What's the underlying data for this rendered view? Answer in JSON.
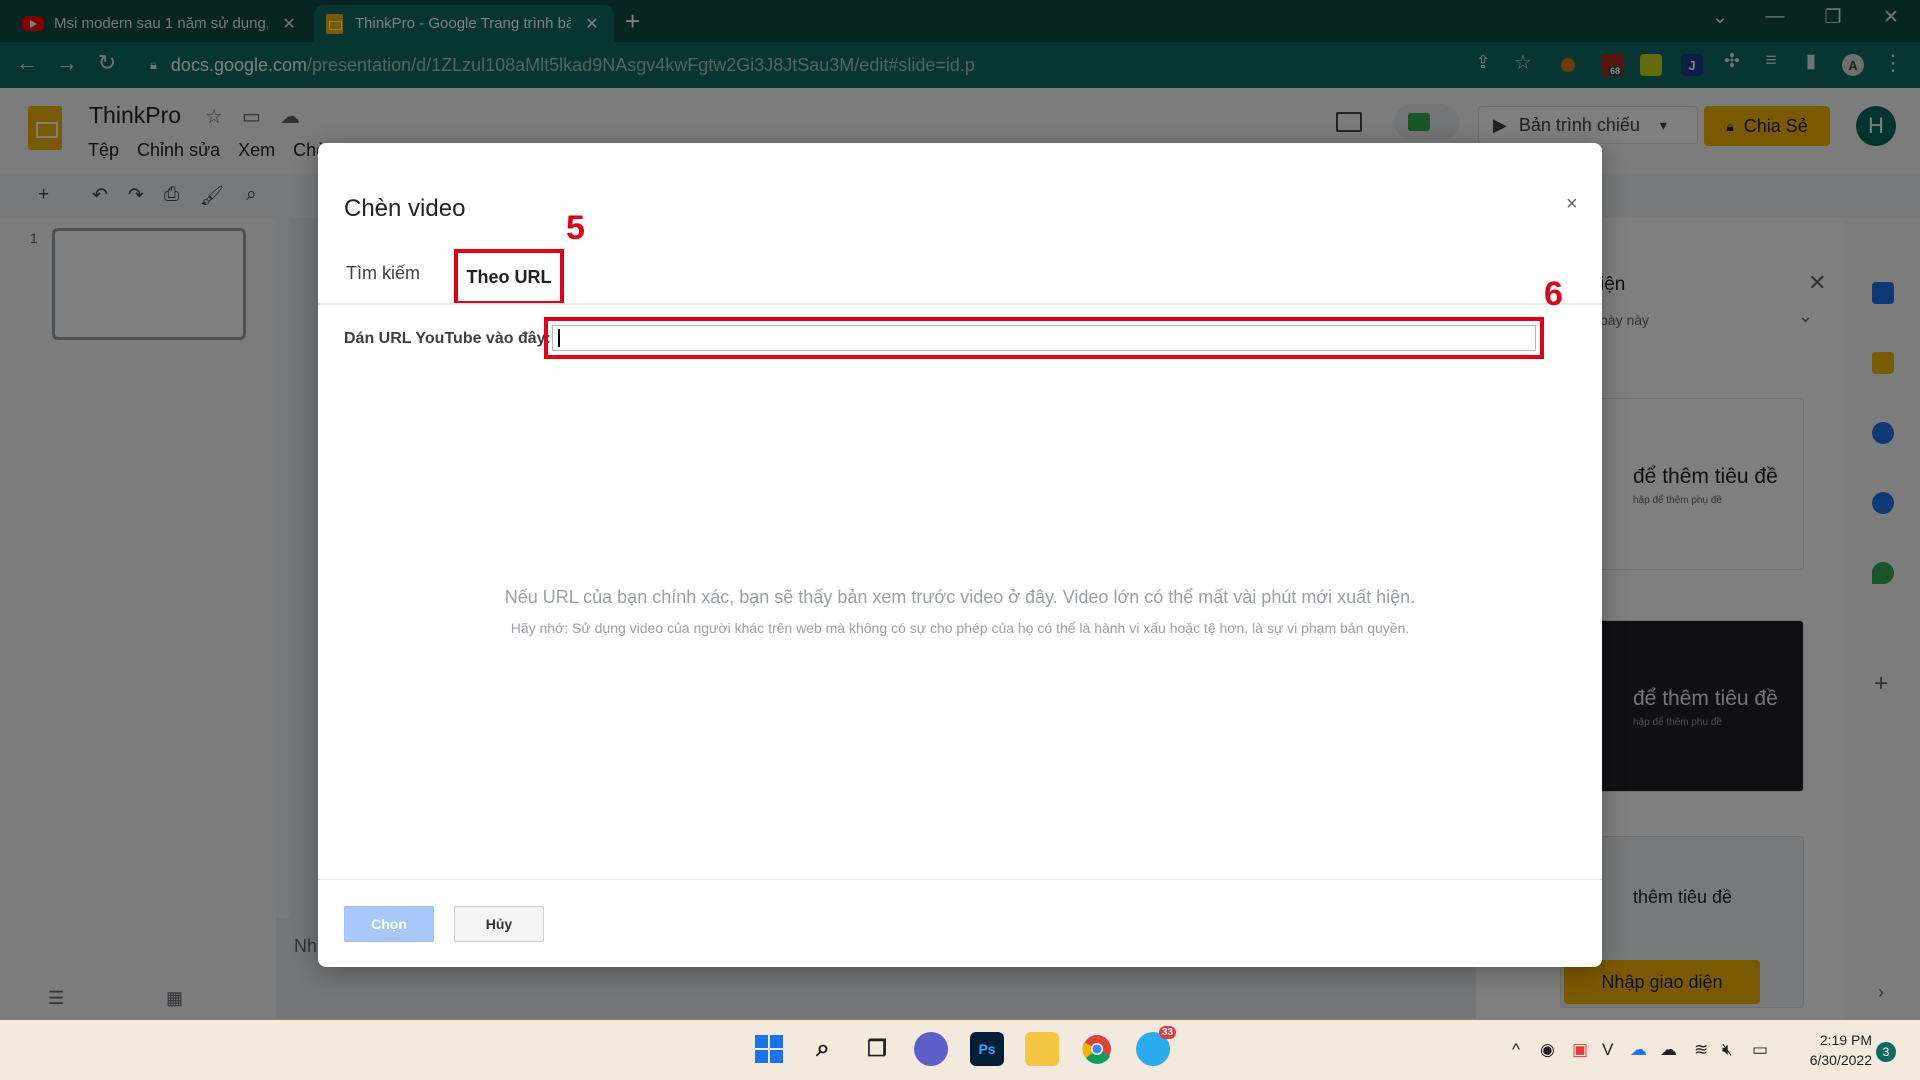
{
  "browser": {
    "tabs": [
      {
        "title": "Msi modern sau 1 năm sử dụng, ",
        "close": "✕",
        "favicon": "youtube-icon"
      },
      {
        "title": "ThinkPro - Google Trang trình bà",
        "close": "✕",
        "favicon": "slides-icon"
      }
    ],
    "new_tab": "+",
    "url_host": "docs.google.com",
    "url_path": "/presentation/d/1ZLzul108aMlt5lkad9NAsgv4kwFgtw2Gi3J8JtSau3M/edit#slide=id.p",
    "extension_badge": "68"
  },
  "slides": {
    "doc_title": "ThinkPro",
    "menu": [
      "Tệp",
      "Chỉnh sửa",
      "Xem",
      "Chè"
    ],
    "present_label": "Bản trình chiếu",
    "share_label": "Chia Sẻ",
    "avatar_letter": "H",
    "slide_number": "1",
    "canvas_note": "Nh",
    "theme_panel": {
      "title": "iện",
      "subtitle": "pày này",
      "cards": [
        {
          "title": "để thêm tiêu đề",
          "sub": "hập để thêm phụ đề"
        },
        {
          "title": "để thêm tiêu đề",
          "sub": "hập để thêm phụ đề"
        },
        {
          "title": "thêm tiêu đề",
          "sub": ""
        }
      ],
      "import_label": "Nhập giao diện"
    }
  },
  "dialog": {
    "title": "Chèn video",
    "close": "×",
    "tab_search": "Tìm kiếm",
    "tab_url": "Theo URL",
    "url_label": "Dán URL YouTube vào đây:",
    "url_value": "",
    "preview_hint": "Nếu URL của bạn chính xác, bạn sẽ thấy bản xem trước video ở đây. Video lớn có thể mất vài phút mới xuất hiện.",
    "copyright_note": "Hãy nhớ: Sử dụng video của người khác trên web mà không có sự cho phép của họ có thể là hành vi xấu hoặc tệ hơn, là sự vi phạm bản quyền.",
    "select_label": "Chọn",
    "cancel_label": "Hủy"
  },
  "annotations": {
    "step_5": "5",
    "step_6": "6"
  },
  "taskbar": {
    "time": "2:19 PM",
    "date": "6/30/2022",
    "notifications": "3",
    "telegram_badge": "33",
    "photoshop_label": "Ps"
  },
  "colors": {
    "highlight_red": "#e20016",
    "chrome_frame": "#0f4a47",
    "slides_yellow": "#f4b400",
    "select_button_disabled": "#a8c7fa"
  }
}
